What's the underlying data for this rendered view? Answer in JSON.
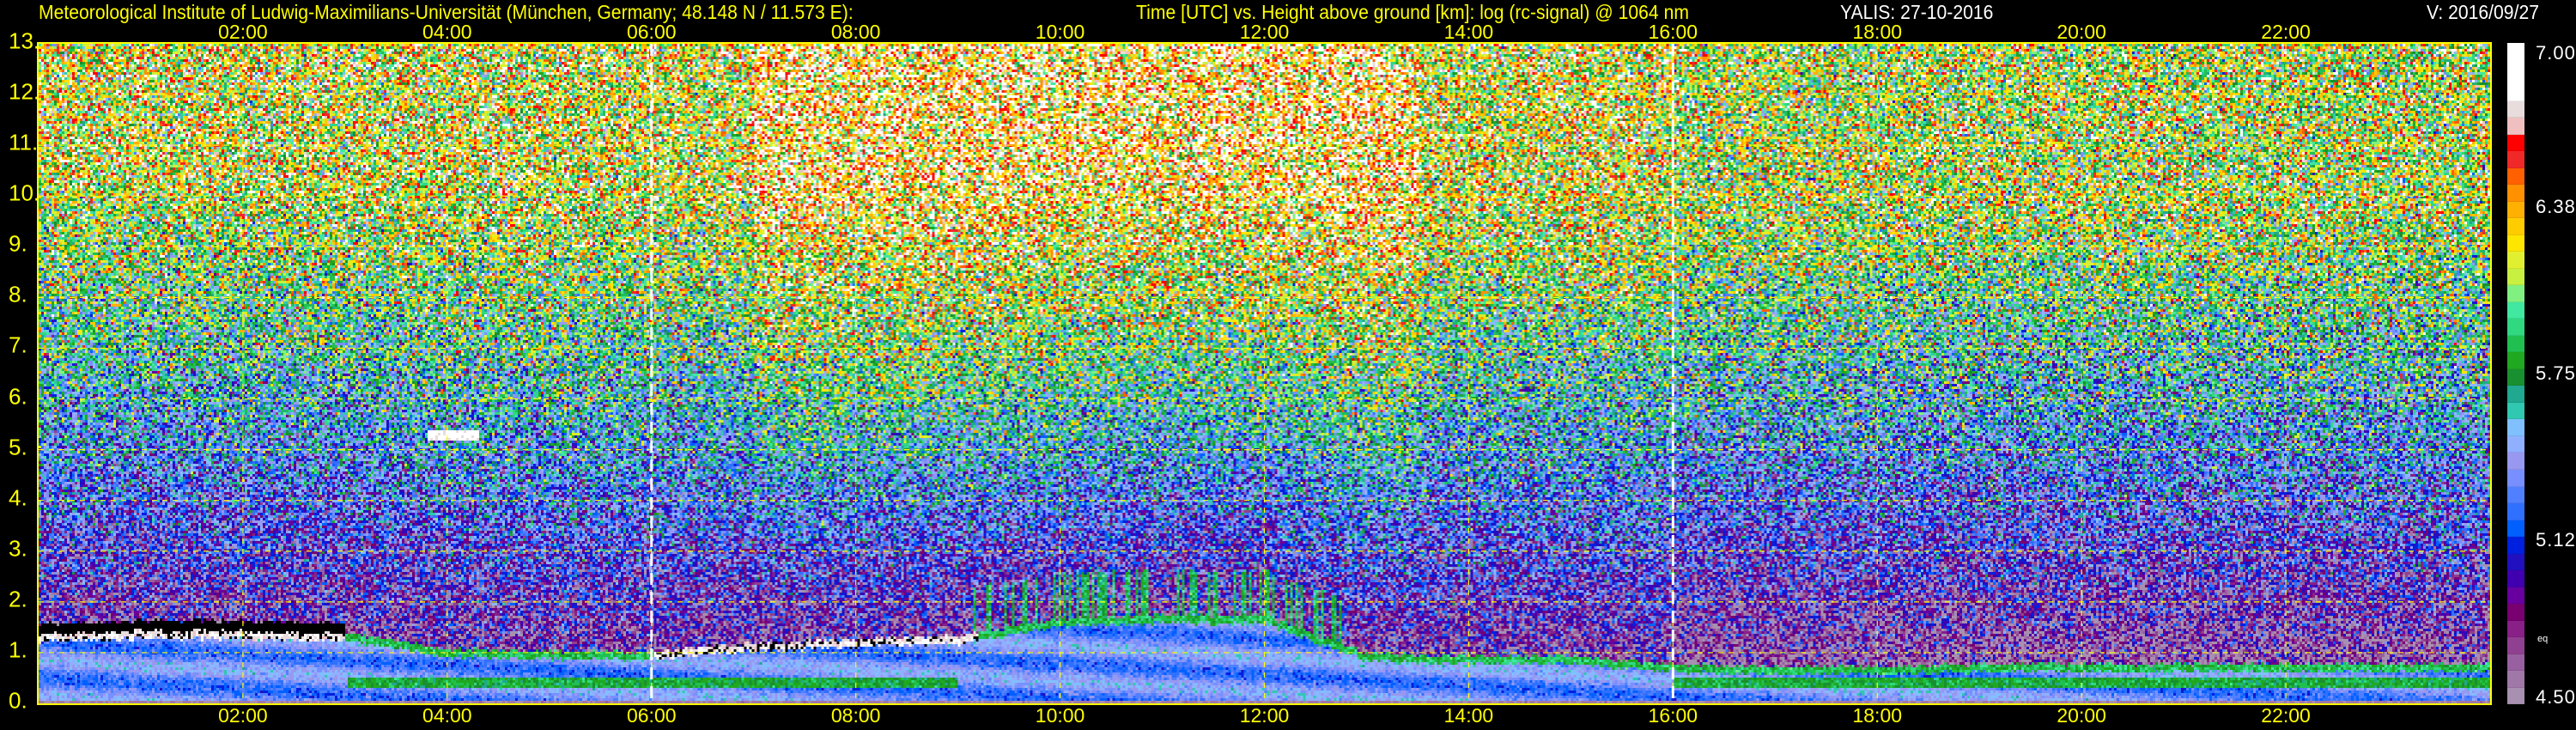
{
  "header": {
    "institute": "Meteorological Institute of Ludwig-Maximilians-Universität (München, Germany; 48.148 N / 11.573 E):",
    "description": "Time [UTC] vs. Height above ground [km]: log (rc-signal) @ 1064 nm",
    "instrument_date": "YALIS: 27-10-2016",
    "version": "V: 2016/09/27"
  },
  "chart_data": {
    "type": "heatmap",
    "title": "Time [UTC] vs. Height above ground [km]: log (rc-signal) @ 1064 nm",
    "xlabel": "Time [UTC]",
    "ylabel": "Height above ground [km]",
    "xlim": [
      0,
      24
    ],
    "ylim": [
      0,
      13
    ],
    "x_ticks": [
      "02:00",
      "04:00",
      "06:00",
      "08:00",
      "10:00",
      "12:00",
      "14:00",
      "16:00",
      "18:00",
      "20:00",
      "22:00"
    ],
    "x_tick_hours": [
      2,
      4,
      6,
      8,
      10,
      12,
      14,
      16,
      18,
      20,
      22
    ],
    "y_ticks": [
      "0.",
      "1.",
      "2.",
      "3.",
      "4.",
      "5.",
      "6.",
      "7.",
      "8.",
      "9.",
      "10.",
      "11.",
      "12.",
      "13."
    ],
    "y_tick_values": [
      0,
      1,
      2,
      3,
      4,
      5,
      6,
      7,
      8,
      9,
      10,
      11,
      12,
      13
    ],
    "grid": true,
    "marker_lines_hours": [
      6,
      16
    ],
    "colorbar": {
      "range": [
        4.5,
        7.0
      ],
      "ticks": [
        {
          "label": "7.00",
          "value": 7.0
        },
        {
          "label": "6.38",
          "value": 6.38
        },
        {
          "label": "5.75",
          "value": 5.75
        },
        {
          "label": "5.12",
          "value": 5.12
        },
        {
          "label": "4.50",
          "value": 4.5
        }
      ],
      "unit_label": "eq",
      "colors": [
        "#ffffff",
        "#e8dcdc",
        "#f0c0c0",
        "#ff0000",
        "#f02828",
        "#ff6000",
        "#ff9000",
        "#ffb000",
        "#ffcc00",
        "#ffe600",
        "#e0f030",
        "#c8f040",
        "#80f080",
        "#40e8a0",
        "#30d880",
        "#20c050",
        "#20a820",
        "#189030",
        "#20a890",
        "#30c8b0",
        "#80c0ff",
        "#90b0ff",
        "#9898f0",
        "#7890ff",
        "#5080ff",
        "#3070ff",
        "#0060ff",
        "#0020e0",
        "#2010c0",
        "#4000b0",
        "#6800a0",
        "#780070",
        "#882088",
        "#904090",
        "#9860a0",
        "#a078a8",
        "#a890b0"
      ]
    },
    "aerosol_layer_top_km": {
      "hours": [
        0,
        1,
        2,
        3,
        4,
        5,
        6,
        7,
        8,
        9,
        10,
        11,
        12,
        13,
        14,
        15,
        16,
        17,
        18,
        19,
        20,
        21,
        22,
        23,
        24
      ],
      "values": [
        1.4,
        1.45,
        1.45,
        1.4,
        1.1,
        1.05,
        1.05,
        1.2,
        1.3,
        1.35,
        1.7,
        1.75,
        1.75,
        1.0,
        0.95,
        0.95,
        0.8,
        0.75,
        0.75,
        0.8,
        0.8,
        0.8,
        0.8,
        0.8,
        0.8
      ]
    }
  }
}
